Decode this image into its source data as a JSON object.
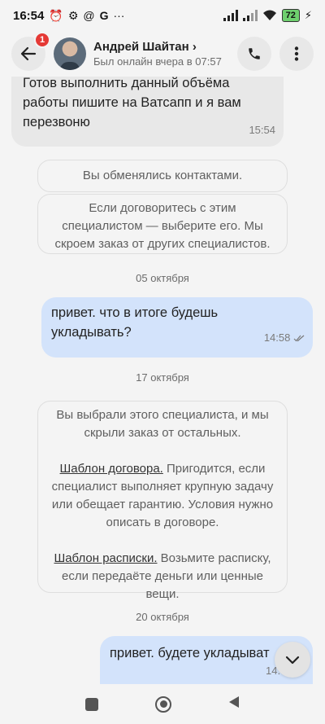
{
  "status_bar": {
    "time": "16:54",
    "notification_icons": [
      "alarm-icon",
      "sync-icon",
      "at-icon",
      "google-icon",
      "more-dots-icon"
    ],
    "battery": "72"
  },
  "header": {
    "notification_count": "1",
    "contact_name": "Андрей Шайтан ›",
    "contact_status": "Был онлайн вчера в 07:57"
  },
  "messages": {
    "incoming_1": {
      "text": "Готов выполнить данный объёма работы пишите на Ватсапп и я вам перезвоню",
      "time": "15:54"
    },
    "system_contacts": "Вы обменялись контактами.",
    "system_choose": "Если договоритесь с этим специалистом — выберите его. Мы скроем заказ от других специалистов.",
    "date_1": "05 октября",
    "outgoing_1": {
      "text": "привет. что в итоге будешь укладывать?",
      "time": "14:58"
    },
    "date_2": "17 октября",
    "system_selected": {
      "intro": "Вы выбрали этого специалиста, и мы скрыли заказ от остальных.",
      "contract_link": "Шаблон договора.",
      "contract_text": " Пригодится, если специалист выполняет крупную задачу или обещает гарантию. Условия нужно описать в договоре.",
      "receipt_link": "Шаблон расписки.",
      "receipt_text": " Возьмите расписку, если передаёте деньги или ценные вещи."
    },
    "date_3": "20 октября",
    "outgoing_2": {
      "text": "привет. будете укладыват",
      "time": "14:"
    }
  },
  "colors": {
    "incoming_bubble": "#e8e8e8",
    "outgoing_bubble": "#d3e3fb",
    "badge": "#e53935",
    "background": "#f4f4f4"
  }
}
